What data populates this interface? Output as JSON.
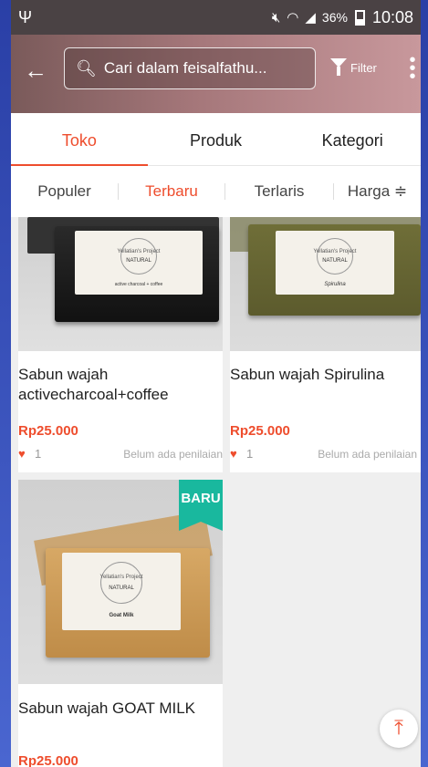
{
  "status_bar": {
    "usb_icon": "usb-icon",
    "battery_percent": "36%",
    "time": "10:08"
  },
  "toolbar": {
    "search_placeholder": "Cari dalam feisalfathu...",
    "filter_label": "Filter"
  },
  "tabs": [
    {
      "label": "Toko",
      "active": true
    },
    {
      "label": "Produk",
      "active": false
    },
    {
      "label": "Kategori",
      "active": false
    }
  ],
  "sort": [
    {
      "label": "Populer",
      "active": false
    },
    {
      "label": "Terbaru",
      "active": true
    },
    {
      "label": "Terlaris",
      "active": false
    },
    {
      "label": "Harga ≑",
      "active": false
    }
  ],
  "products": [
    {
      "name": "Sabun wajah activecharcoal+coffee",
      "price": "Rp25.000",
      "likes": "1",
      "rating": "Belum ada penilaian",
      "badge": "",
      "label_text": "active charcoal + coffee"
    },
    {
      "name": "Sabun wajah Spirulina",
      "price": "Rp25.000",
      "likes": "1",
      "rating": "Belum ada penilaian",
      "badge": "",
      "label_text": "Spirulina"
    },
    {
      "name": "Sabun wajah GOAT MILK",
      "price": "Rp25.000",
      "likes": "",
      "rating": "",
      "badge": "BARU",
      "label_text": "Goat Milk"
    }
  ],
  "soap_brand": {
    "line1": "Yellatian's Project",
    "line2": "NATURAL"
  },
  "colors": {
    "accent": "#ee4d2d",
    "badge": "#19b89e"
  }
}
